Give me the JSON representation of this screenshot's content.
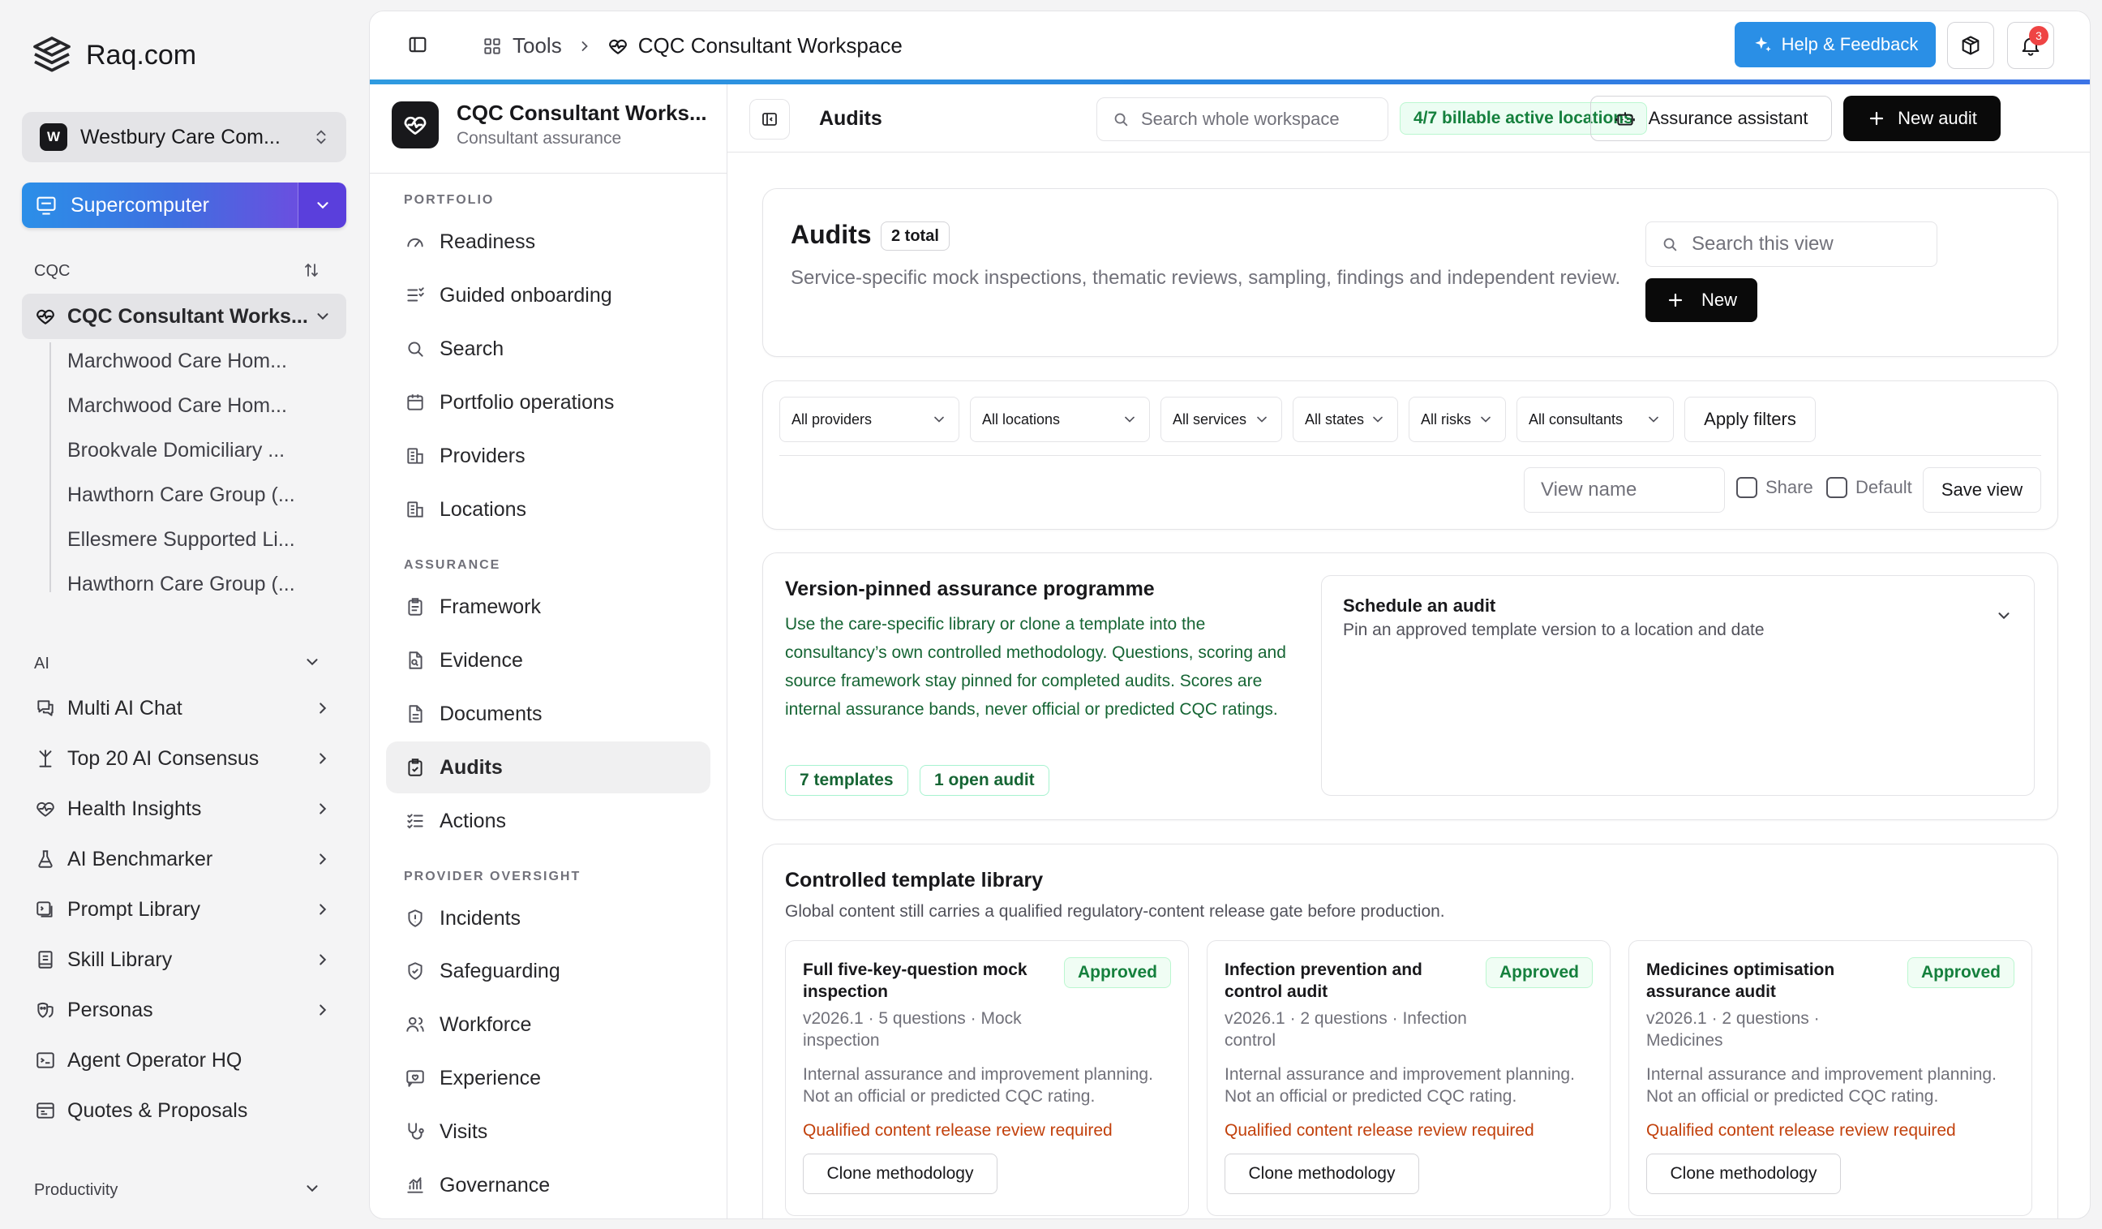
{
  "brand": {
    "name": "Raq.com"
  },
  "org": {
    "initial": "W",
    "name": "Westbury Care Com..."
  },
  "supercomputer": {
    "label": "Supercomputer"
  },
  "sidebar": {
    "cqc_label": "CQC",
    "workspace_item": "CQC Consultant Works...",
    "workspace_children": [
      "Marchwood Care Hom...",
      "Marchwood Care Hom...",
      "Brookvale Domiciliary ...",
      "Hawthorn Care Group (...",
      "Ellesmere Supported Li...",
      "Hawthorn Care Group (..."
    ],
    "ai_label": "AI",
    "ai_items": [
      {
        "label": "Multi AI Chat",
        "icon": "chat-icon"
      },
      {
        "label": "Top 20 AI Consensus",
        "icon": "branch-icon"
      },
      {
        "label": "Health Insights",
        "icon": "heart-pulse-icon"
      },
      {
        "label": "AI Benchmarker",
        "icon": "flask-icon"
      },
      {
        "label": "Prompt Library",
        "icon": "prompt-icon"
      },
      {
        "label": "Skill Library",
        "icon": "book-icon"
      },
      {
        "label": "Personas",
        "icon": "persona-icon"
      },
      {
        "label": "Agent Operator HQ",
        "icon": "terminal-icon"
      },
      {
        "label": "Quotes & Proposals",
        "icon": "quote-icon"
      }
    ],
    "productivity_label": "Productivity"
  },
  "topbar": {
    "crumb_tools": "Tools",
    "crumb_current": "CQC Consultant Workspace",
    "help_label": "Help & Feedback",
    "notif_count": "3"
  },
  "workspace": {
    "title": "CQC Consultant Works...",
    "subtitle": "Consultant assurance",
    "sections": [
      {
        "label": "PORTFOLIO"
      },
      {
        "label": "ASSURANCE"
      },
      {
        "label": "PROVIDER OVERSIGHT"
      }
    ],
    "items": [
      "Readiness",
      "Guided onboarding",
      "Search",
      "Portfolio operations",
      "Providers",
      "Locations",
      "Framework",
      "Evidence",
      "Documents",
      "Audits",
      "Actions",
      "Incidents",
      "Safeguarding",
      "Workforce",
      "Experience",
      "Visits",
      "Governance"
    ]
  },
  "content_header": {
    "title": "Audits",
    "search_placeholder": "Search whole workspace",
    "billable": "4/7 billable active locations",
    "assistant_label": "Assurance assistant",
    "new_audit_label": "New audit"
  },
  "audits_card": {
    "title": "Audits",
    "total": "2 total",
    "description": "Service-specific mock inspections, thematic reviews, sampling, findings and independent review.",
    "search_placeholder": "Search this view",
    "new_label": "New"
  },
  "filters": {
    "providers": "All providers",
    "locations": "All locations",
    "services": "All services",
    "states": "All states",
    "risks": "All risks",
    "consultants": "All consultants",
    "apply_label": "Apply filters",
    "view_name_placeholder": "View name",
    "share_label": "Share",
    "default_label": "Default",
    "save_view_label": "Save view"
  },
  "programme": {
    "title": "Version-pinned assurance programme",
    "description": "Use the care-specific library or clone a template into the consultancy’s own controlled methodology. Questions, scoring and source framework stay pinned for completed audits. Scores are internal assurance bands, never official or predicted CQC ratings.",
    "chip_templates": "7 templates",
    "chip_open": "1 open audit",
    "schedule_title": "Schedule an audit",
    "schedule_sub": "Pin an approved template version to a location and date"
  },
  "library": {
    "title": "Controlled template library",
    "subtitle": "Global content still carries a qualified regulatory-content release gate before production.",
    "templates": [
      {
        "title": "Full five-key-question mock inspection",
        "status": "Approved",
        "meta": "v2026.1 · 5 questions · Mock inspection",
        "note": "Internal assurance and improvement planning. Not an official or predicted CQC rating.",
        "warning": "Qualified content release review required",
        "clone_label": "Clone methodology"
      },
      {
        "title": "Infection prevention and control audit",
        "status": "Approved",
        "meta": "v2026.1 · 2 questions · Infection control",
        "note": "Internal assurance and improvement planning. Not an official or predicted CQC rating.",
        "warning": "Qualified content release review required",
        "clone_label": "Clone methodology"
      },
      {
        "title": "Medicines optimisation assurance audit",
        "status": "Approved",
        "meta": "v2026.1 · 2 questions · Medicines",
        "note": "Internal assurance and improvement planning. Not an official or predicted CQC rating.",
        "warning": "Qualified content release review required",
        "clone_label": "Clone methodology"
      }
    ]
  }
}
